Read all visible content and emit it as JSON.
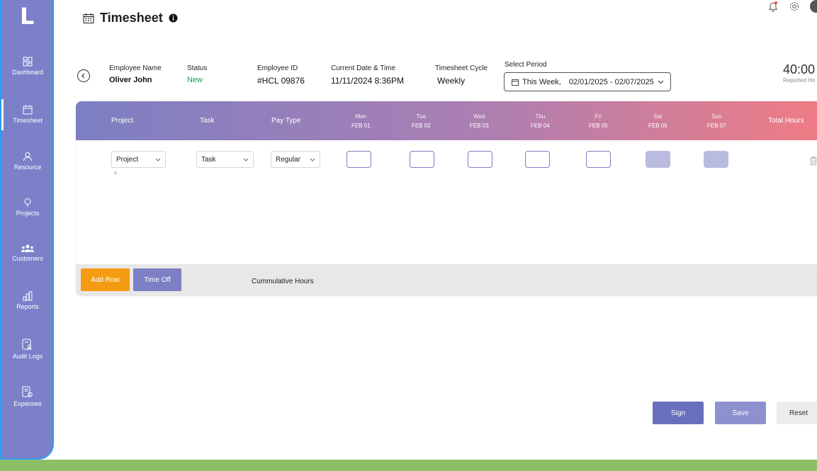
{
  "app": {
    "logo": "L"
  },
  "sidebar": {
    "items": [
      {
        "label": "Dashboard",
        "icon": "dashboard-icon"
      },
      {
        "label": "Timesheet",
        "icon": "calendar-icon",
        "active": true
      },
      {
        "label": "Resource",
        "icon": "user-icon"
      },
      {
        "label": "Projects",
        "icon": "lightbulb-icon"
      },
      {
        "label": "Customers",
        "icon": "users-group-icon"
      },
      {
        "label": "Reports",
        "icon": "bar-chart-icon"
      },
      {
        "label": "Audit Logs",
        "icon": "audit-doc-icon"
      },
      {
        "label": "Expenses",
        "icon": "expense-doc-icon"
      }
    ]
  },
  "header": {
    "title": "Timesheet"
  },
  "employee": {
    "name_label": "Employee Name",
    "name": "Oliver John",
    "status_label": "Status",
    "status": "New",
    "id_label": "Employee ID",
    "id": "#HCL 09876",
    "datetime_label": "Current Date & Time",
    "datetime": "11/11/2024 8:36PM",
    "cycle_label": "Timesheet Cycle",
    "cycle": "Weekly",
    "period_label": "Select Period",
    "period_week": "This Week,",
    "period_range": "02/01/2025 - 02/07/2025"
  },
  "reported": {
    "hours": "40:00",
    "label": "Reported Ho"
  },
  "table": {
    "headers": {
      "project": "Project",
      "task": "Task",
      "pay_type": "Pay Type",
      "total": "Total Hours"
    },
    "days": [
      {
        "day": "Mon",
        "date": "FEB 01"
      },
      {
        "day": "Tue",
        "date": "FEB 02"
      },
      {
        "day": "Wed",
        "date": "FEB 03"
      },
      {
        "day": "Thu",
        "date": "FEB 04"
      },
      {
        "day": "Fri",
        "date": "FEB 05"
      },
      {
        "day": "Sat",
        "date": "FEB 06"
      },
      {
        "day": "Sun",
        "date": "FEB 07"
      }
    ],
    "row": {
      "project": "Project",
      "task": "Task",
      "pay_type": "Regular",
      "add": "+"
    },
    "footer": {
      "add_row": "Add Row",
      "time_off": "Time Off",
      "cumulative": "Cummulative Hours"
    }
  },
  "actions": {
    "sign": "Sign",
    "save": "Save",
    "reset": "Reset"
  },
  "colors": {
    "sidebar": "#7b80c9",
    "accent": "#7c7fc3",
    "add_row": "#f49b12",
    "status_new": "#1c9a4c",
    "gradient_end": "#ef7c85"
  }
}
